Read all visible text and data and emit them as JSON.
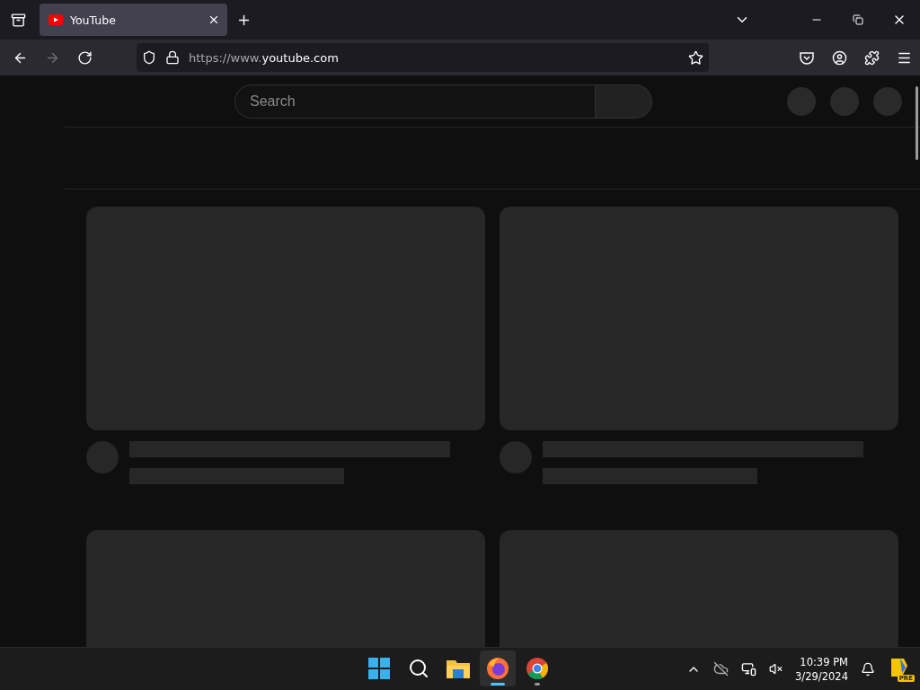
{
  "browser": {
    "tabs": [
      {
        "title": "YouTube",
        "selected": true
      }
    ],
    "nav": [
      {
        "kind": "back",
        "disabled": false
      },
      {
        "kind": "forward",
        "disabled": true
      },
      {
        "kind": "reload",
        "disabled": false
      }
    ],
    "address": {
      "prefix": "https://www.",
      "domain": "youtube.com"
    }
  },
  "page": {
    "search": {
      "placeholder": "Search"
    },
    "header_buttons": [
      {
        "kind": "placeholder"
      },
      {
        "kind": "placeholder"
      },
      {
        "kind": "placeholder"
      }
    ],
    "videos": [
      {
        "kind": "skeleton"
      },
      {
        "kind": "skeleton"
      },
      {
        "kind": "skeleton"
      },
      {
        "kind": "skeleton"
      }
    ]
  },
  "taskbar": {
    "apps": [
      {
        "kind": "start",
        "open": false,
        "active": false
      },
      {
        "kind": "search",
        "open": false,
        "active": false
      },
      {
        "kind": "explorer",
        "open": false,
        "active": false
      },
      {
        "kind": "firefox",
        "open": true,
        "active": true
      },
      {
        "kind": "chrome",
        "open": true,
        "active": false
      }
    ],
    "clock": {
      "time": "10:39 PM",
      "date": "3/29/2024"
    },
    "badge": "PRE"
  }
}
